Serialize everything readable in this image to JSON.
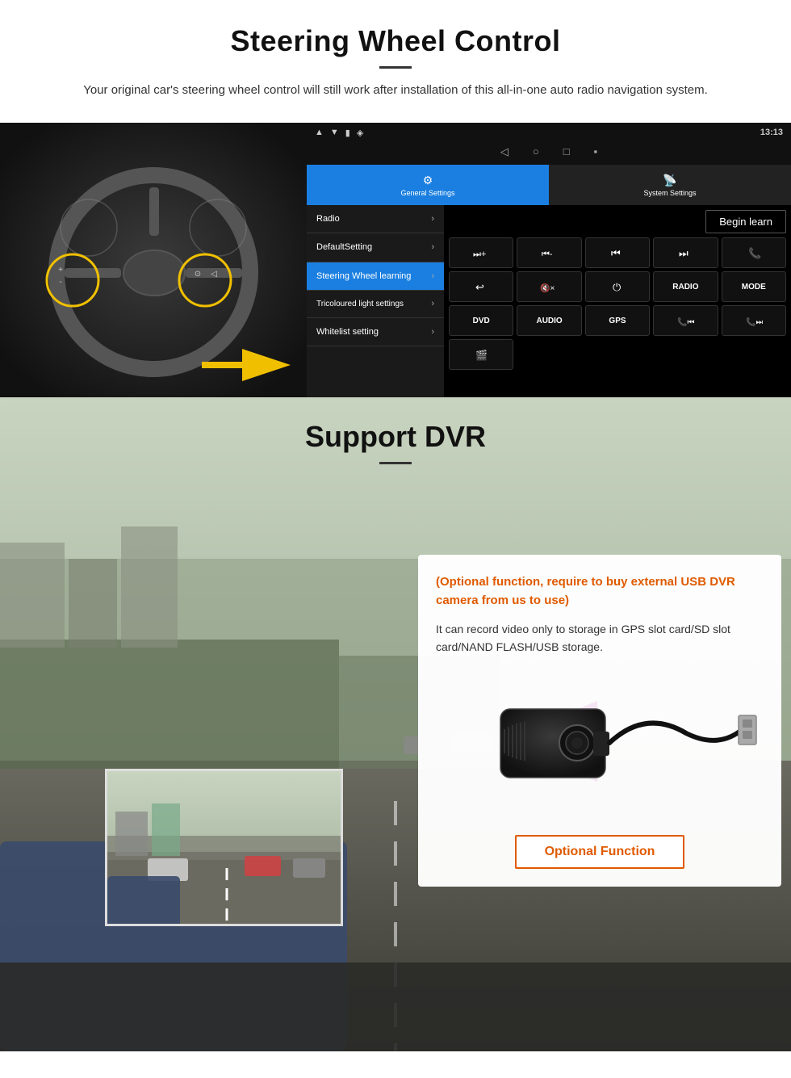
{
  "page": {
    "section1": {
      "title": "Steering Wheel Control",
      "subtitle": "Your original car's steering wheel control will still work after installation of this all-in-one auto radio navigation system.",
      "statusbar": {
        "time": "13:13",
        "signal": "▾",
        "wifi": "▾"
      },
      "tabs": {
        "general": "General Settings",
        "system": "System Settings"
      },
      "menu": {
        "items": [
          {
            "label": "Radio",
            "active": false
          },
          {
            "label": "DefaultSetting",
            "active": false
          },
          {
            "label": "Steering Wheel learning",
            "active": true
          },
          {
            "label": "Tricoloured light settings",
            "active": false
          },
          {
            "label": "Whitelist setting",
            "active": false
          }
        ]
      },
      "begin_learn": "Begin learn",
      "controls": {
        "row1": [
          "⏭+",
          "⏮-",
          "⏮⏮",
          "⏭⏭",
          "📞"
        ],
        "row2": [
          "↩",
          "🔇x",
          "⏻",
          "RADIO",
          "MODE"
        ],
        "row3": [
          "DVD",
          "AUDIO",
          "GPS",
          "📞⏮",
          "📞⏭"
        ],
        "row4": [
          "🎬"
        ]
      }
    },
    "section2": {
      "title": "Support DVR",
      "card": {
        "optional_text": "(Optional function, require to buy external USB DVR camera from us to use)",
        "description": "It can record video only to storage in GPS slot card/SD slot card/NAND FLASH/USB storage.",
        "button_label": "Optional Function"
      }
    }
  }
}
